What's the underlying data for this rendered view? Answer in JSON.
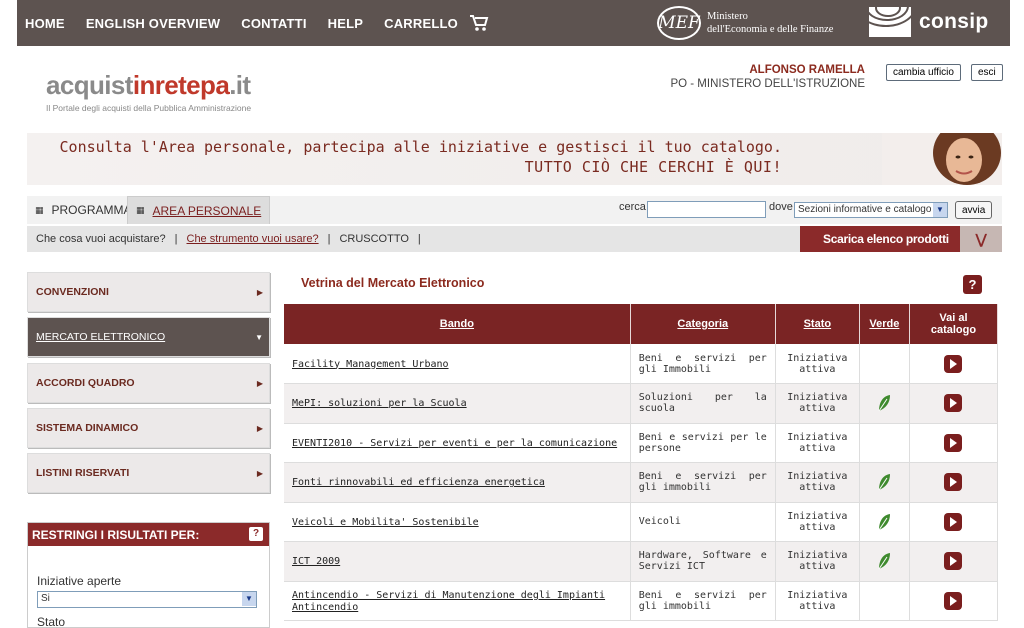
{
  "top_nav": {
    "items": [
      "HOME",
      "ENGLISH OVERVIEW",
      "CONTATTI",
      "HELP",
      "CARRELLO"
    ],
    "mef_logo": "MEF",
    "mef_line1": "Ministero",
    "mef_line2": "dell'Economia e delle Finanze",
    "consip": "consip"
  },
  "logo": {
    "part1": "acquist",
    "part2": "inrete",
    "part3": "pa",
    "part4": ".it",
    "tagline": "Il Portale degli acquisti della Pubblica Amministrazione"
  },
  "user": {
    "name": "ALFONSO RAMELLA",
    "office": "PO - MINISTERO DELL'ISTRUZIONE",
    "change_office": "cambia ufficio",
    "logout": "esci"
  },
  "banner": {
    "line1": "Consulta l'Area personale, partecipa alle iniziative e gestisci il tuo catalogo.",
    "line2": "TUTTO CIÒ CHE CERCHI È QUI!"
  },
  "tabs": [
    "PROGRAMMA",
    "AREA PERSONALE"
  ],
  "search": {
    "label": "cerca",
    "value": "",
    "where_label": "dove",
    "where_value": "Sezioni informative e catalogo",
    "submit": "avvia"
  },
  "subnav": {
    "item1": "Che cosa vuoi acquistare?",
    "item2": "Che strumento vuoi usare?",
    "item3": "CRUSCOTTO",
    "sep": "|",
    "download": "Scarica elenco prodotti"
  },
  "sidebar": {
    "items": [
      "CONVENZIONI",
      "MERCATO ELETTRONICO",
      "ACCORDI QUADRO",
      "SISTEMA DINAMICO",
      "LISTINI RISERVATI"
    ],
    "filter_title": "RESTRINGI I RISULTATI PER:",
    "filter_label1": "Iniziative aperte",
    "filter_value1": "Si",
    "filter_label2": "Stato"
  },
  "vetrina": {
    "title": "Vetrina del Mercato Elettronico",
    "help": "?",
    "headers": [
      "Bando",
      "Categoria",
      "Stato",
      "Verde",
      "Vai al catalogo"
    ],
    "rows": [
      {
        "bando": "Facility Management Urbano",
        "categoria": "Beni e servizi per gli Immobili",
        "stato": "Iniziativa attiva",
        "verde": false
      },
      {
        "bando": "MePI: soluzioni per la Scuola",
        "categoria": "Soluzioni per la scuola",
        "stato": "Iniziativa attiva",
        "verde": true
      },
      {
        "bando": "EVENTI2010 - Servizi per eventi e per la comunicazione",
        "categoria": "Beni e servizi per le persone",
        "stato": "Iniziativa attiva",
        "verde": false
      },
      {
        "bando": "Fonti rinnovabili ed efficienza energetica",
        "categoria": "Beni e servizi per gli immobili",
        "stato": "Iniziativa attiva",
        "verde": true
      },
      {
        "bando": "Veicoli e Mobilita' Sostenibile",
        "categoria": "Veicoli",
        "stato": "Iniziativa attiva",
        "verde": true
      },
      {
        "bando": "ICT 2009",
        "categoria": "Hardware, Software e Servizi ICT",
        "stato": "Iniziativa attiva",
        "verde": true
      },
      {
        "bando": "Antincendio - Servizi di Manutenzione degli Impianti Antincendio",
        "categoria": "Beni e servizi per gli immobili",
        "stato": "Iniziativa attiva",
        "verde": false
      }
    ]
  },
  "colors": {
    "brand_dark": "#5d5350",
    "accent": "#8b2a2a",
    "green": "#3f8a2e"
  }
}
